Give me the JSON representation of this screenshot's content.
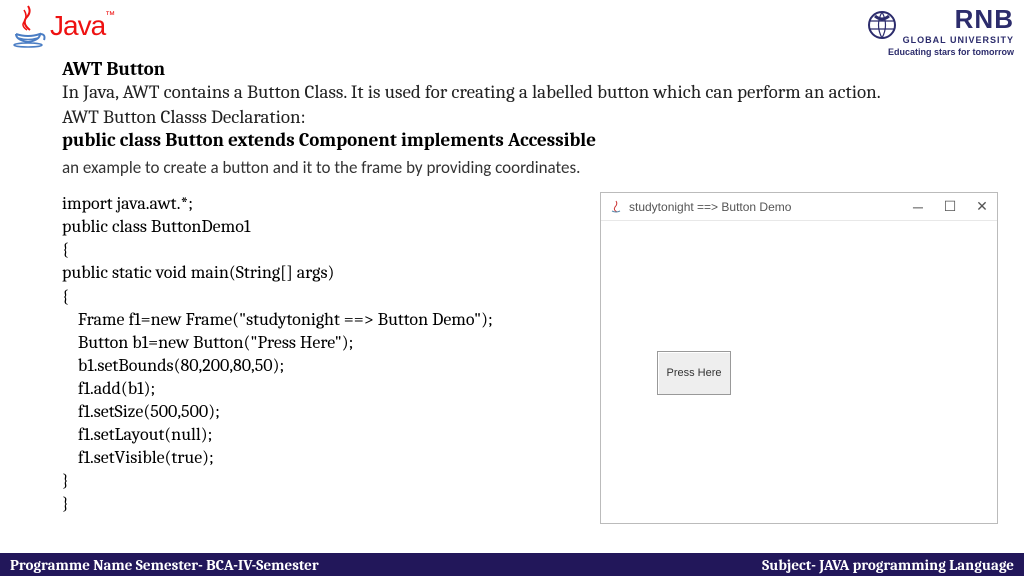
{
  "header": {
    "java_brand": "Java",
    "rnb_brand": "RNB",
    "rnb_sub": "GLOBAL UNIVERSITY",
    "rnb_tag": "Educating stars for tomorrow"
  },
  "content": {
    "title": "AWT Button",
    "intro": "In Java, AWT contains a Button Class. It is used for creating a labelled button which can perform an action.",
    "decl_label": "AWT Button Classs Declaration:",
    "decl": "public class Button extends Component implements Accessible",
    "example_text": "an example to create a button and it to the frame by providing coordinates.",
    "code": "import java.awt.*;\npublic class ButtonDemo1\n{\npublic static void main(String[] args)\n{\n    Frame f1=new Frame(\"studytonight ==> Button Demo\");\n    Button b1=new Button(\"Press Here\");\n    b1.setBounds(80,200,80,50);\n    f1.add(b1);\n    f1.setSize(500,500);\n    f1.setLayout(null);\n    f1.setVisible(true);\n}\n}"
  },
  "demo": {
    "title": "studytonight ==> Button Demo",
    "button_label": "Press Here"
  },
  "footer": {
    "left": "Programme Name Semester- BCA-IV-Semester",
    "right": "Subject- JAVA programming Language"
  }
}
